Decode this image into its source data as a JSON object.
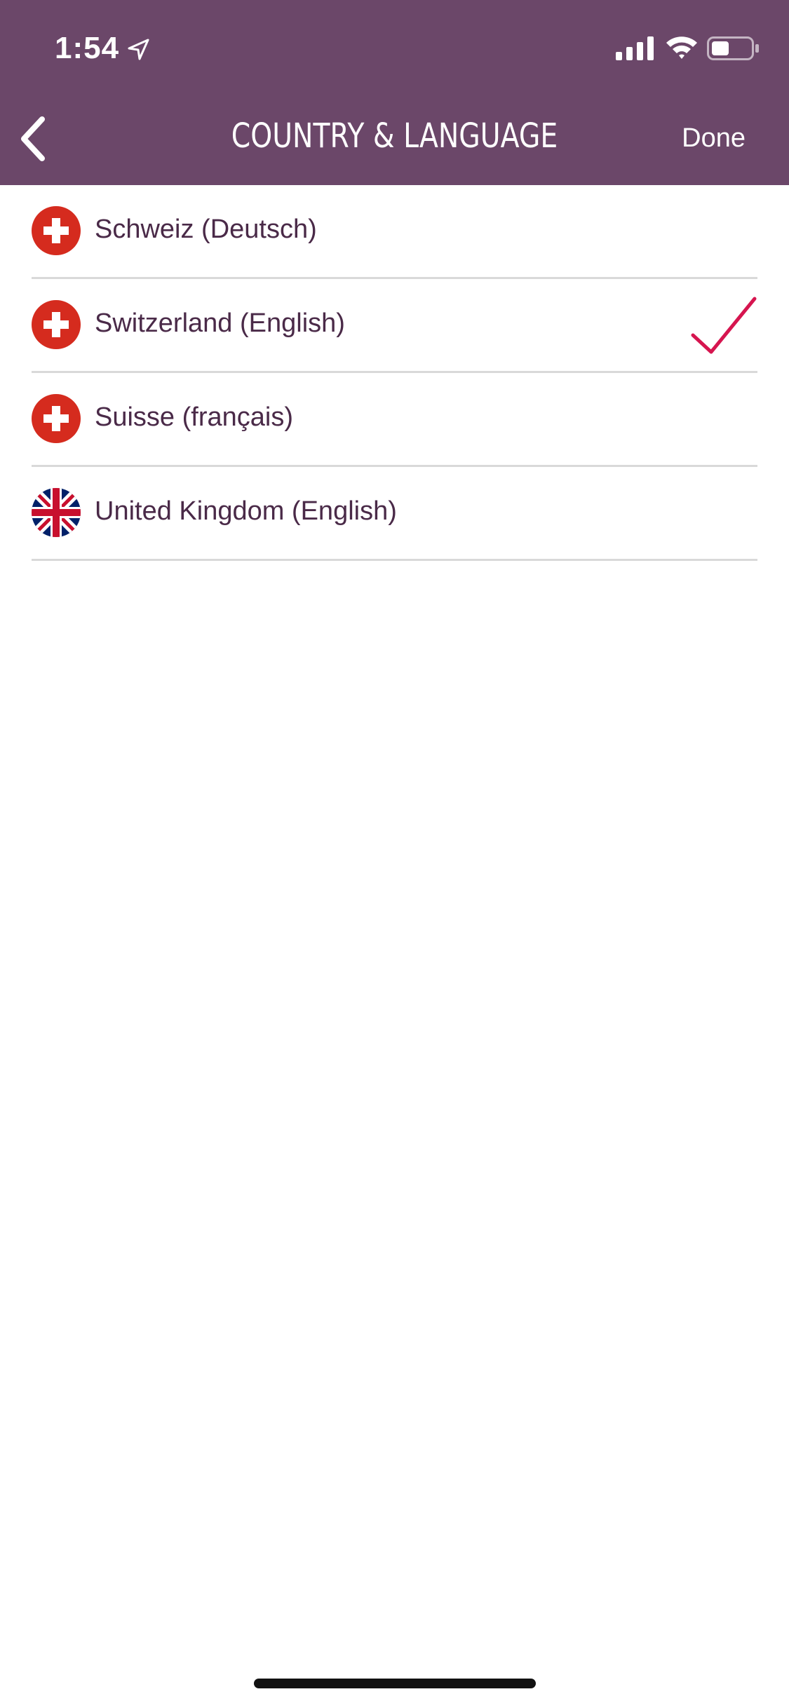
{
  "status_bar": {
    "time": "1:54"
  },
  "nav": {
    "title": "COUNTRY & LANGUAGE",
    "done_label": "Done"
  },
  "colors": {
    "header_bg": "#6b4769",
    "checkmark": "#d6154f",
    "label_text": "#4a2a48",
    "divider": "#d9d9d9"
  },
  "countries": [
    {
      "label": "Schweiz (Deutsch)",
      "flag": "swiss-flag-icon",
      "selected": false
    },
    {
      "label": "Switzerland (English)",
      "flag": "swiss-flag-icon",
      "selected": true
    },
    {
      "label": "Suisse (français)",
      "flag": "swiss-flag-icon",
      "selected": false
    },
    {
      "label": "United Kingdom (English)",
      "flag": "uk-flag-icon",
      "selected": false
    }
  ]
}
